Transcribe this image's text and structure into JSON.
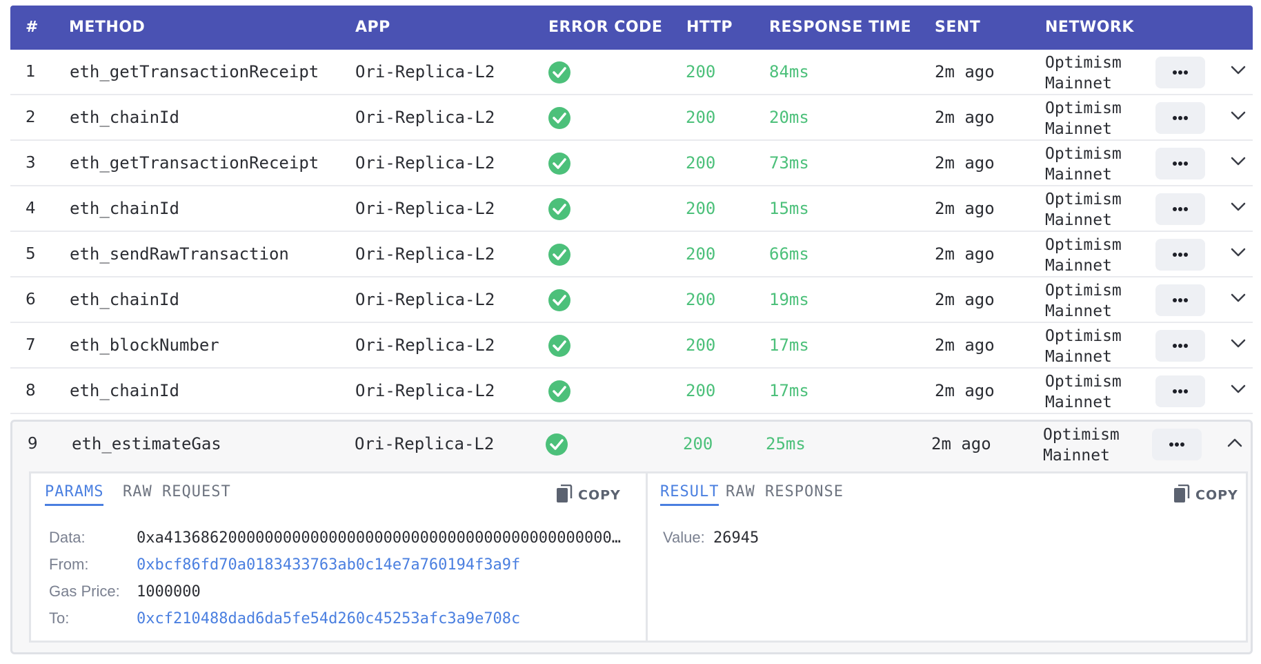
{
  "columns": {
    "num": "#",
    "method": "METHOD",
    "app": "APP",
    "error_code": "ERROR CODE",
    "http": "HTTP",
    "response_time": "RESPONSE TIME",
    "sent": "SENT",
    "network": "NETWORK"
  },
  "rows": [
    {
      "num": "1",
      "method": "eth_getTransactionReceipt",
      "app": "Ori-Replica-L2",
      "http": "200",
      "response_time": "84ms",
      "sent": "2m ago",
      "network_line1": "Optimism",
      "network_line2": "Mainnet"
    },
    {
      "num": "2",
      "method": "eth_chainId",
      "app": "Ori-Replica-L2",
      "http": "200",
      "response_time": "20ms",
      "sent": "2m ago",
      "network_line1": "Optimism",
      "network_line2": "Mainnet"
    },
    {
      "num": "3",
      "method": "eth_getTransactionReceipt",
      "app": "Ori-Replica-L2",
      "http": "200",
      "response_time": "73ms",
      "sent": "2m ago",
      "network_line1": "Optimism",
      "network_line2": "Mainnet"
    },
    {
      "num": "4",
      "method": "eth_chainId",
      "app": "Ori-Replica-L2",
      "http": "200",
      "response_time": "15ms",
      "sent": "2m ago",
      "network_line1": "Optimism",
      "network_line2": "Mainnet"
    },
    {
      "num": "5",
      "method": "eth_sendRawTransaction",
      "app": "Ori-Replica-L2",
      "http": "200",
      "response_time": "66ms",
      "sent": "2m ago",
      "network_line1": "Optimism",
      "network_line2": "Mainnet"
    },
    {
      "num": "6",
      "method": "eth_chainId",
      "app": "Ori-Replica-L2",
      "http": "200",
      "response_time": "19ms",
      "sent": "2m ago",
      "network_line1": "Optimism",
      "network_line2": "Mainnet"
    },
    {
      "num": "7",
      "method": "eth_blockNumber",
      "app": "Ori-Replica-L2",
      "http": "200",
      "response_time": "17ms",
      "sent": "2m ago",
      "network_line1": "Optimism",
      "network_line2": "Mainnet"
    },
    {
      "num": "8",
      "method": "eth_chainId",
      "app": "Ori-Replica-L2",
      "http": "200",
      "response_time": "17ms",
      "sent": "2m ago",
      "network_line1": "Optimism",
      "network_line2": "Mainnet"
    }
  ],
  "expanded_row": {
    "num": "9",
    "method": "eth_estimateGas",
    "app": "Ori-Replica-L2",
    "http": "200",
    "response_time": "25ms",
    "sent": "2m ago",
    "network_line1": "Optimism",
    "network_line2": "Mainnet"
  },
  "request_panel": {
    "tab_params": "PARAMS",
    "tab_raw": "RAW REQUEST",
    "copy_label": "COPY",
    "fields": [
      {
        "label": "Data:",
        "value": "0xa41368620000000000000000000000000000000000000000000000000000000000000000000"
      },
      {
        "label": "From:",
        "value": "0xbcf86fd70a0183433763ab0c14e7a760194f3a9f"
      },
      {
        "label": "Gas Price:",
        "value": "1000000"
      },
      {
        "label": "To:",
        "value": "0xcf210488dad6da5fe54d260c45253afc3a9e708c"
      }
    ]
  },
  "response_panel": {
    "tab_result": "RESULT",
    "tab_raw": "RAW RESPONSE",
    "copy_label": "COPY",
    "value_label": "Value:",
    "value": "26945"
  },
  "colors": {
    "header_bg": "#4a52b3",
    "success": "#4cc07a",
    "link": "#4a7fe0"
  }
}
